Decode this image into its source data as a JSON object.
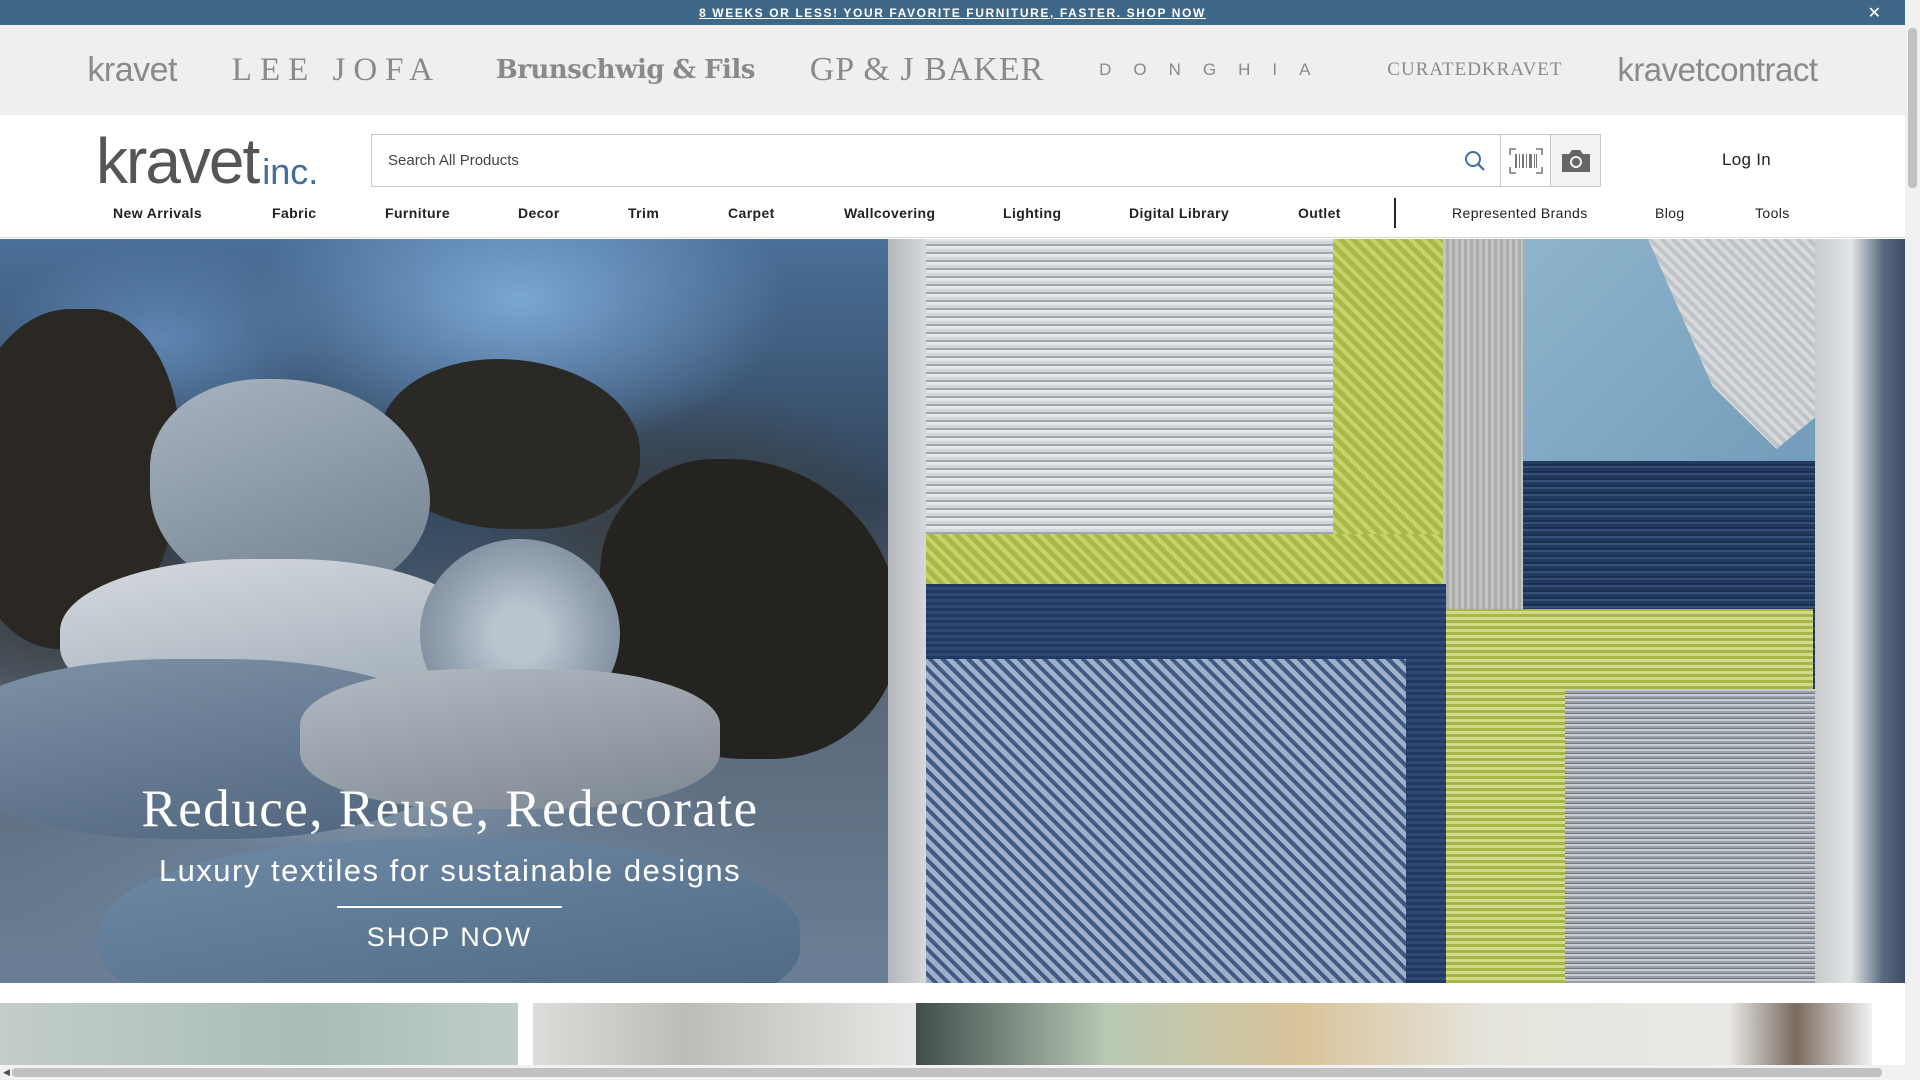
{
  "announcement": {
    "text": "8 WEEKS OR LESS! YOUR FAVORITE FURNITURE, FASTER. SHOP NOW",
    "close_icon": "close-icon"
  },
  "brands": [
    "kravet",
    "LEE JOFA",
    "Brunschwig & Fils",
    "GP & J BAKER",
    "DONGHIA",
    "CURATEDKRAVET",
    "kravetcontract"
  ],
  "header": {
    "logo_main": "kravet",
    "logo_suffix": "inc.",
    "search_placeholder": "Search All Products",
    "search_icon": "search-icon",
    "barcode_icon": "barcode-icon",
    "camera_icon": "camera-icon",
    "login_label": "Log In"
  },
  "nav": {
    "primary": [
      "New Arrivals",
      "Fabric",
      "Furniture",
      "Decor",
      "Trim",
      "Carpet",
      "Wallcovering",
      "Lighting",
      "Digital Library",
      "Outlet"
    ],
    "secondary": [
      "Represented Brands",
      "Blog",
      "Tools"
    ]
  },
  "hero": {
    "title": "Reduce, Reuse, Redecorate",
    "subtitle": "Luxury textiles for sustainable designs",
    "cta": "SHOP NOW"
  },
  "colors": {
    "announcement_bg": "#3f6888",
    "brand_strip_bg": "#efefef",
    "logo_accent": "#3f6d9d"
  }
}
